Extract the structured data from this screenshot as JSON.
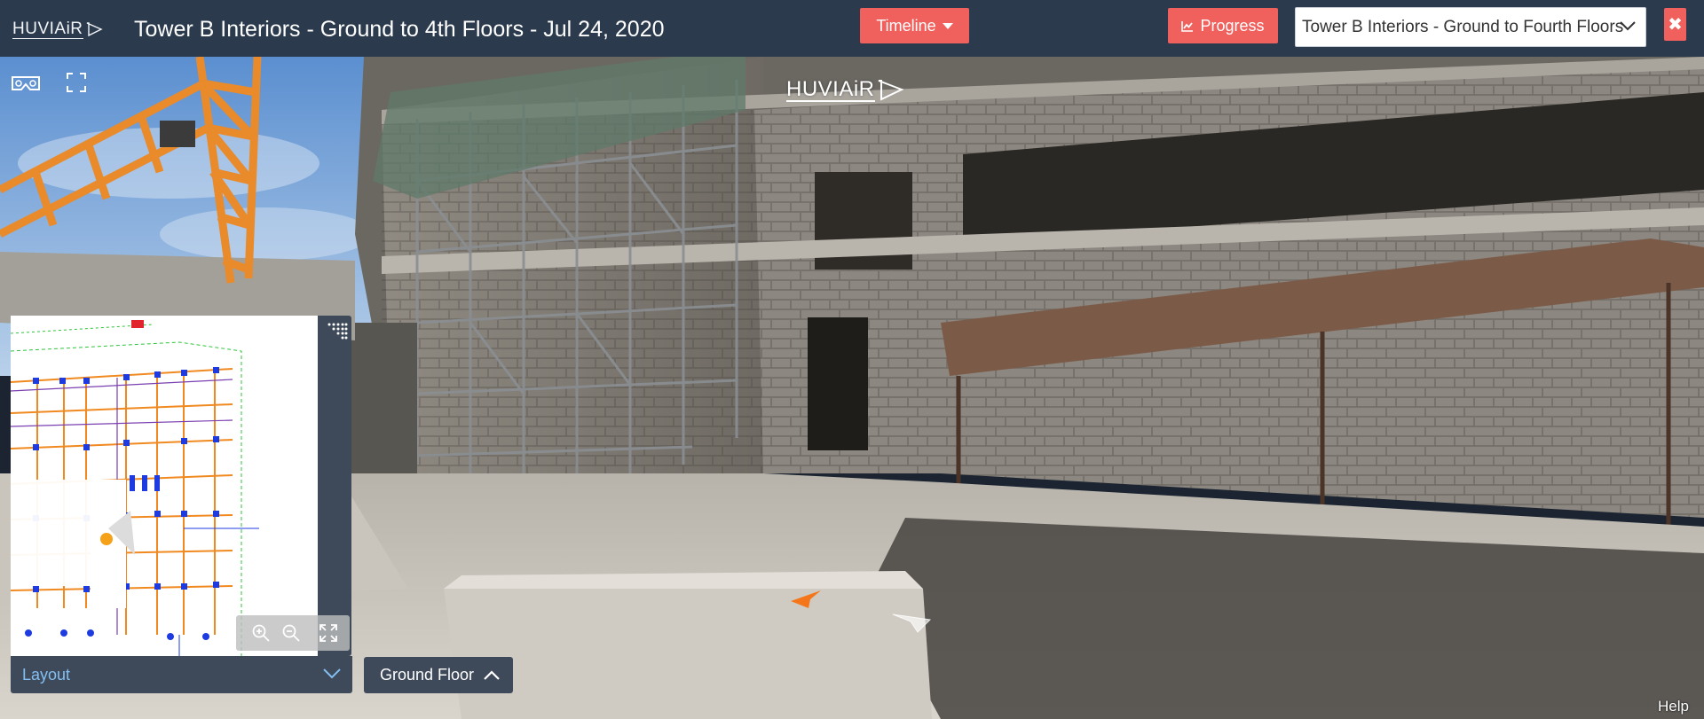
{
  "header": {
    "brand": "HUVIAiR",
    "title": "Tower B Interiors - Ground to 4th Floors - Jul 24, 2020",
    "timeline_label": "Timeline",
    "progress_label": "Progress",
    "project_select_value": "Tower B Interiors - Ground to Fourth Floors",
    "close_label": "✖"
  },
  "viewer": {
    "watermark": "HUVIAiR",
    "controls": [
      "vr-headset-icon",
      "fullscreen-icon"
    ],
    "nav_markers": [
      "orange-arrow-icon",
      "white-arrow-icon"
    ]
  },
  "minimap": {
    "layout_label": "Layout",
    "floor_label": "Ground Floor",
    "tools": [
      "zoom-in-icon",
      "zoom-out-icon",
      "expand-icon",
      "grid-icon"
    ]
  },
  "footer": {
    "help_label": "Help"
  },
  "colors": {
    "topbar": "#2b3a4d",
    "accent_red": "#f0605c",
    "panel": "#3e4a5a",
    "layout_text": "#84bff2"
  }
}
